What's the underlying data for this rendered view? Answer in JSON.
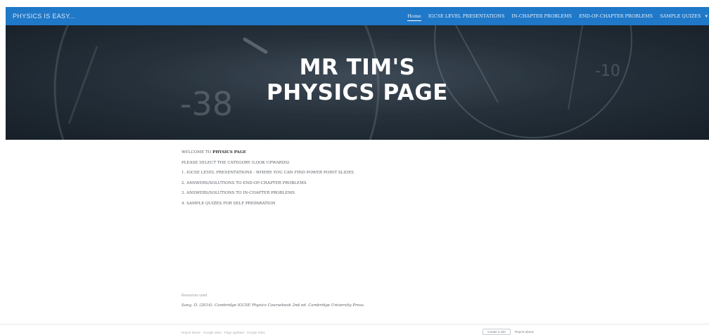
{
  "brand": "PHYSICS IS EASY...",
  "nav": {
    "items": [
      {
        "label": "Home",
        "active": true
      },
      {
        "label": "IGCSE LEVEL PRESENTATIONS"
      },
      {
        "label": "IN-CHAPTER PROBLEMS"
      },
      {
        "label": "END-OF-CHAPTER PROBLEMS"
      },
      {
        "label": "SAMPLE QUIZES"
      }
    ],
    "more_icon": "more-icon"
  },
  "hero": {
    "title_line1": "MR TIM'S",
    "title_line2": "PHYSICS PAGE",
    "chalk_1": "-38",
    "chalk_2": "-10"
  },
  "content": {
    "welcome_prefix": "WELCOME TO ",
    "welcome_bold": "PHYSICS PAGE",
    "instruction": "PLEASE SELECT THE CATEGORY (LOOK UPWARDS)",
    "items": [
      "1. IGCSE LEVEL PRESENTATIONS - WHERE YOU CAN FIND POWER POINT SLIDES",
      "2. ANSWERS/SOLUTIONS TO END-OF-CHAPTER PROBLEMS",
      "3. ANSWERS/SOLUTIONS TO IN-CHAPTER PROBLEMS",
      "4. SAMPLE QUIZES FOR SELF PREPARATION"
    ]
  },
  "sources": {
    "heading": "Resources used",
    "citation": "Sang, D. (2014). Cambridge IGCSE Physics Coursebook 2nd ed. Cambridge University Press."
  },
  "footer": {
    "text": "Report abuse · Google Sites · Page updated · Google Sites",
    "create_label": "Create a site",
    "report_label": "Report abuse"
  },
  "colors": {
    "navbar": "#1f78c8",
    "hero_dark": "#1a232c",
    "text": "#555b62"
  }
}
